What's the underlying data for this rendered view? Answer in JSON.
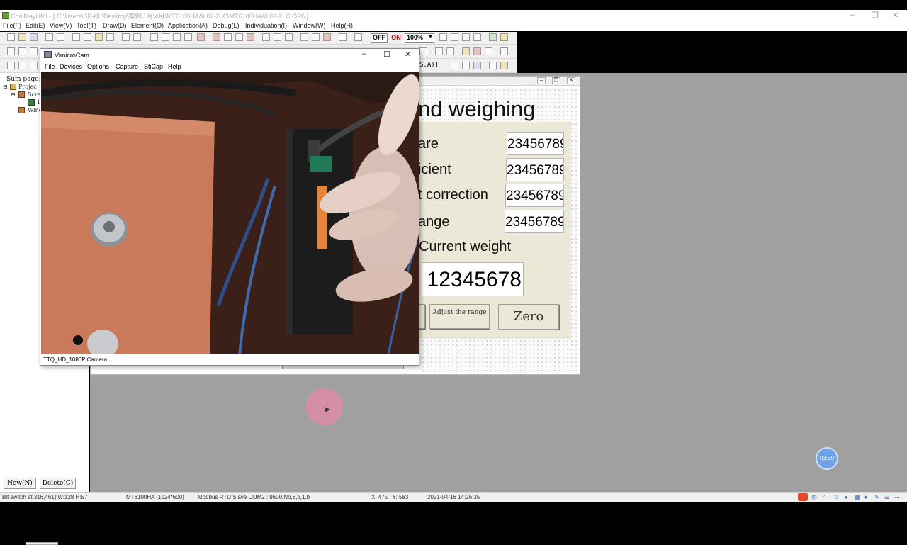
{
  "app": {
    "title": "CoolMayHMI - [ C:\\Users\\SB-KL\\Desktop\\案例\\1月\\4月\\MT6100HA&L02-2LC\\MT6100HA&L02-2LC.OP6 ]",
    "menu": [
      "File(F)",
      "Edit(E)",
      "View(V)",
      "Tool(T)",
      "Draw(D)",
      "Element(O)",
      "Application(A)",
      "Debug(L)",
      "Individuation(I)",
      "Window(W)",
      "Help(H)"
    ],
    "toolbar": {
      "off_label": "OFF",
      "on_label": "ON",
      "zoom": "100%",
      "partial_text": "S.A)]"
    }
  },
  "project_panel": {
    "header": "Sum page:",
    "tree": [
      "Projec",
      "Scre",
      "1",
      "Winc"
    ],
    "new_button": "New(N)",
    "delete_button": "Delete(C)"
  },
  "camera_window": {
    "title": "VimicroCam",
    "menu": [
      "File",
      "Devices",
      "Options",
      "Capture",
      "StiCap",
      "Help"
    ],
    "status": "TTQ_HD_1080P Camera"
  },
  "hmi_screen": {
    "title": "nd weighing",
    "rows": [
      {
        "label": "are",
        "value": "23456789"
      },
      {
        "label": "icient",
        "value": "23456789"
      },
      {
        "label": "t correction",
        "value": "23456789"
      },
      {
        "label": "ange",
        "value": "23456789"
      }
    ],
    "current_weight_label": "Current weight",
    "current_weight_value": "12345678",
    "adjust_button": "Adjust the range",
    "zero_button": "Zero"
  },
  "statusbar": {
    "element": "Bit switch at[316,461] W:128  H:57",
    "model": "MT6100HA (1024*600)",
    "protocol": "Modbus RTU Slave  COM2 : 9600,No,8,b,1,b",
    "coords": "X: 475 , Y: 583",
    "datetime": "2021-04-16  14:26:35"
  },
  "recording_timer": "03:30",
  "colors": {
    "hmi_panel": "#ebe8d8",
    "workspace": "#a0a0a0",
    "cursor_highlight": "#e08aa8",
    "timer_badge": "#6fa3e8"
  }
}
